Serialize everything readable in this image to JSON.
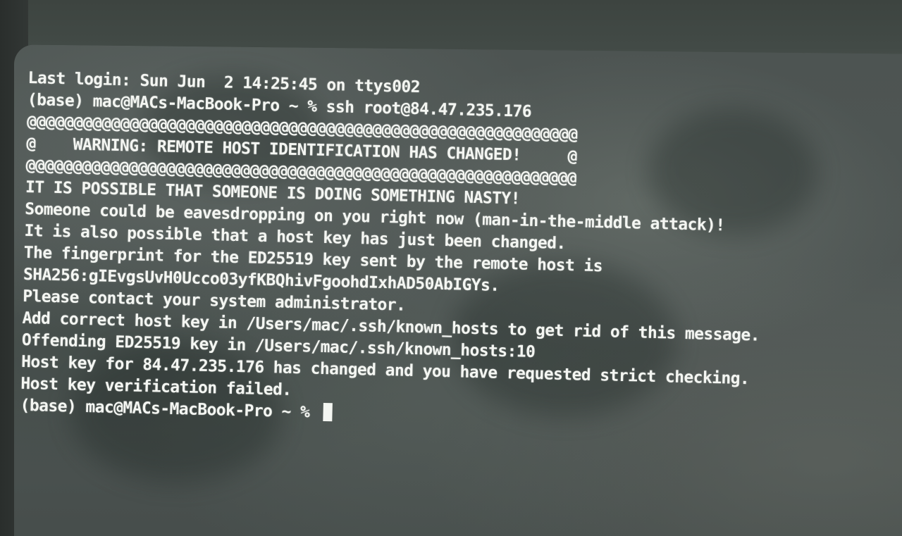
{
  "terminal": {
    "lines": [
      "Last login: Sun Jun  2 14:25:45 on ttys002",
      "(base) mac@MACs-MacBook-Pro ~ % ssh root@84.47.235.176",
      "@@@@@@@@@@@@@@@@@@@@@@@@@@@@@@@@@@@@@@@@@@@@@@@@@@@@@@@@@@@",
      "@    WARNING: REMOTE HOST IDENTIFICATION HAS CHANGED!     @",
      "@@@@@@@@@@@@@@@@@@@@@@@@@@@@@@@@@@@@@@@@@@@@@@@@@@@@@@@@@@@",
      "IT IS POSSIBLE THAT SOMEONE IS DOING SOMETHING NASTY!",
      "Someone could be eavesdropping on you right now (man-in-the-middle attack)!",
      "It is also possible that a host key has just been changed.",
      "The fingerprint for the ED25519 key sent by the remote host is",
      "SHA256:gIEvgsUvH0Ucco03yfKBQhivFgoohdIxhAD50AbIGYs.",
      "Please contact your system administrator.",
      "Add correct host key in /Users/mac/.ssh/known_hosts to get rid of this message.",
      "Offending ED25519 key in /Users/mac/.ssh/known_hosts:10",
      "Host key for 84.47.235.176 has changed and you have requested strict checking.",
      "Host key verification failed."
    ],
    "prompt": "(base) mac@MACs-MacBook-Pro ~ % "
  }
}
